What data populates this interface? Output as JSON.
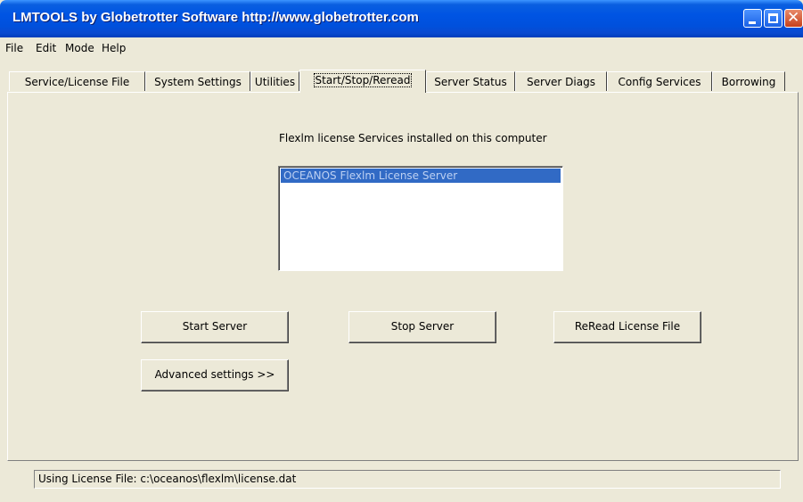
{
  "window": {
    "title": "LMTOOLS by Globetrotter Software http://www.globetrotter.com",
    "controls": {
      "minimize": "minimize-icon",
      "maximize": "maximize-icon",
      "close": "close-icon"
    }
  },
  "menu": [
    "File",
    "Edit",
    "Mode",
    "Help"
  ],
  "tabs": [
    {
      "label": "Service/License File"
    },
    {
      "label": "System Settings"
    },
    {
      "label": "Utilities"
    },
    {
      "label": "Start/Stop/Reread",
      "active": true
    },
    {
      "label": "Server Status"
    },
    {
      "label": "Server Diags"
    },
    {
      "label": "Config Services"
    },
    {
      "label": "Borrowing"
    }
  ],
  "panel": {
    "caption": "Flexlm license Services installed on this computer",
    "services": [
      "OCEANOS Flexlm License Server"
    ],
    "selected_index": 0,
    "buttons": {
      "start": "Start Server",
      "stop": "Stop Server",
      "reread": "ReRead License File",
      "advanced": "Advanced settings >>"
    }
  },
  "status": {
    "text": "Using License File:  c:\\oceanos\\flexlm\\license.dat"
  },
  "colors": {
    "window_bg": "#ece9d8",
    "titlebar": "#0054e3",
    "selection": "#316ac5"
  }
}
